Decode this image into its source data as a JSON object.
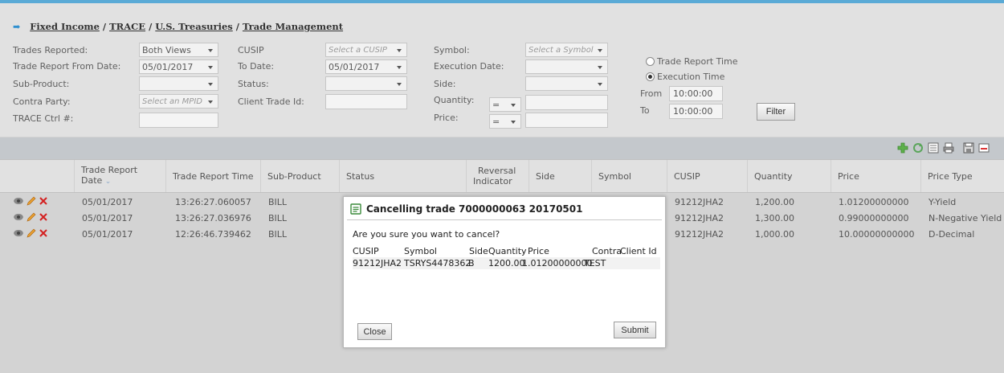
{
  "breadcrumb": [
    "Fixed Income",
    "TRACE",
    "U.S. Treasuries",
    "Trade Management"
  ],
  "filters": {
    "trades_reported_label": "Trades Reported:",
    "trades_reported_value": "Both Views",
    "from_date_label": "Trade Report From Date:",
    "from_date_value": "05/01/2017",
    "sub_product_label": "Sub-Product:",
    "contra_party_label": "Contra Party:",
    "contra_party_placeholder": "Select an MPID",
    "trace_ctrl_label": "TRACE Ctrl #:",
    "cusip_label": "CUSIP",
    "cusip_placeholder": "Select a CUSIP",
    "to_date_label": "To Date:",
    "to_date_value": "05/01/2017",
    "status_label": "Status:",
    "client_trade_id_label": "Client Trade Id:",
    "symbol_label": "Symbol:",
    "symbol_placeholder": "Select a Symbol",
    "execution_date_label": "Execution Date:",
    "side_label": "Side:",
    "quantity_label": "Quantity:",
    "quantity_op": "=",
    "price_label": "Price:",
    "price_op": "=",
    "radio_trade_report_time": "Trade Report Time",
    "radio_execution_time": "Execution Time",
    "from_label": "From",
    "from_time": "10:00:00",
    "to_label": "To",
    "to_time": "10:00:00",
    "filter_button": "Filter"
  },
  "columns": {
    "trade_report_date": "Trade Report",
    "trade_report_date_2": "Date",
    "trade_report_time": "Trade Report Time",
    "sub_product": "Sub-Product",
    "status": "Status",
    "reversal": "Reversal",
    "reversal_2": "Indicator",
    "side": "Side",
    "symbol": "Symbol",
    "cusip": "CUSIP",
    "quantity": "Quantity",
    "price": "Price",
    "price_type": "Price Type"
  },
  "rows": [
    {
      "date": "05/01/2017",
      "time": "13:26:27.060057",
      "sub": "BILL",
      "cusip": "91212JHA2",
      "qty": "1,200.00",
      "price": "1.01200000000",
      "ptype": "Y-Yield"
    },
    {
      "date": "05/01/2017",
      "time": "13:26:27.036976",
      "sub": "BILL",
      "cusip": "91212JHA2",
      "qty": "1,300.00",
      "price": "0.99000000000",
      "ptype": "N-Negative Yield"
    },
    {
      "date": "05/01/2017",
      "time": "12:26:46.739462",
      "sub": "BILL",
      "cusip": "91212JHA2",
      "qty": "1,000.00",
      "price": "10.00000000000",
      "ptype": "D-Decimal"
    }
  ],
  "dialog": {
    "title": "Cancelling trade 7000000063 20170501",
    "question": "Are you sure you want to cancel?",
    "headers": {
      "cusip": "CUSIP",
      "symbol": "Symbol",
      "side": "Side",
      "quantity": "Quantity",
      "price": "Price",
      "contra": "Contra",
      "client_id": "Client Id"
    },
    "row": {
      "cusip": "91212JHA2",
      "symbol": "TSRYS4478362",
      "side": "B",
      "quantity": "1200.00",
      "price": "1.01200000000",
      "contra": "TEST"
    },
    "close": "Close",
    "submit": "Submit"
  },
  "colors": {
    "accent": "#5aaad6",
    "panel": "#e1e1e1",
    "toolbar": "#c4c8cc",
    "overlay": "#d3d3d3"
  }
}
